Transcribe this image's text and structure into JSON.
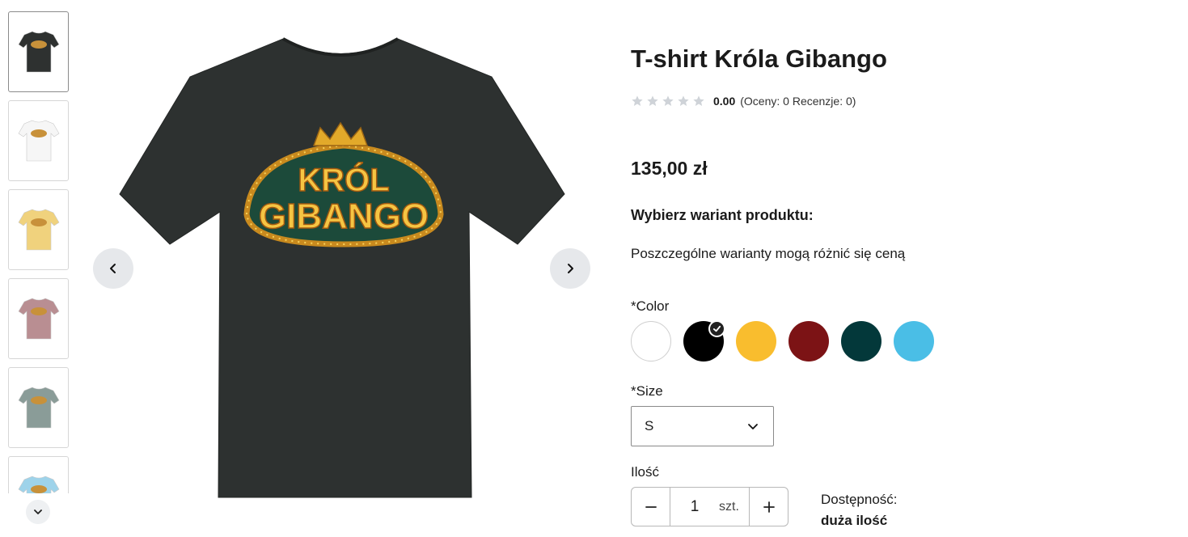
{
  "gallery": {
    "thumbnails": [
      {
        "name": "black",
        "color": "#2e3130"
      },
      {
        "name": "white",
        "color": "#f6f6f6"
      },
      {
        "name": "yellow",
        "color": "#f0d27d"
      },
      {
        "name": "mauve",
        "color": "#b98e92"
      },
      {
        "name": "sage",
        "color": "#8a9c98"
      },
      {
        "name": "light-blue",
        "color": "#9ed3ea"
      }
    ],
    "main_shirt_color": "#2d3130",
    "print_text_top": "KRÓL",
    "print_text_bottom": "GIBANGO",
    "icons": {
      "prev": "chevron-left-icon",
      "next": "chevron-right-icon",
      "scroll_down": "chevron-down-icon"
    }
  },
  "product": {
    "title": "T-shirt Króla Gibango",
    "rating": {
      "stars_filled": 0,
      "stars_total": 5,
      "value": "0.00",
      "counts": "(Oceny: 0 Recenzje: 0)"
    },
    "price": "135,00 zł",
    "variant_heading": "Wybierz wariant produktu:",
    "variant_note": "Poszczególne warianty mogą różnić się ceną",
    "color": {
      "label": "*Color",
      "swatches": [
        {
          "name": "white",
          "hex": "#ffffff",
          "selected": false
        },
        {
          "name": "black",
          "hex": "#000000",
          "selected": true
        },
        {
          "name": "yellow",
          "hex": "#f9bd2e",
          "selected": false
        },
        {
          "name": "burgundy",
          "hex": "#7c1315",
          "selected": false
        },
        {
          "name": "dark-green",
          "hex": "#03383a",
          "selected": false
        },
        {
          "name": "sky-blue",
          "hex": "#4abee6",
          "selected": false
        }
      ]
    },
    "size": {
      "label": "*Size",
      "selected": "S"
    },
    "quantity": {
      "label": "Ilość",
      "value": "1",
      "unit": "szt."
    },
    "availability": {
      "label": "Dostępność:",
      "value": "duża ilość"
    }
  }
}
